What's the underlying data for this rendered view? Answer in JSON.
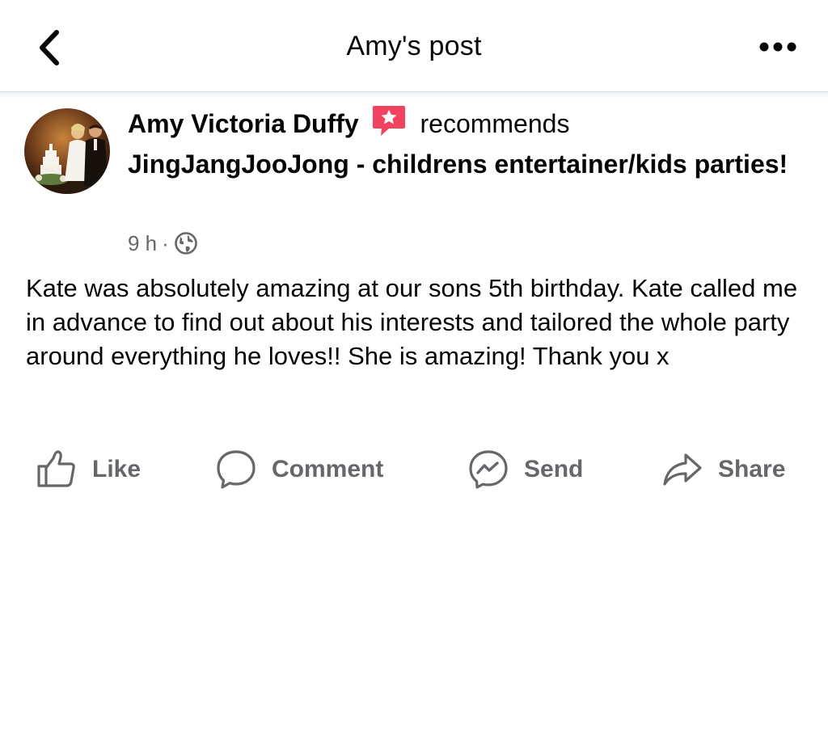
{
  "header": {
    "title": "Amy's post",
    "back_icon": "chevron-left-icon",
    "more_icon": "more-horizontal-icon"
  },
  "post": {
    "author_name": "Amy Victoria Duffy",
    "recommend_icon": "star-speech-bubble-icon",
    "recommend_verb": "recommends",
    "page_name": "JingJangJooJong - childrens entertainer/kids parties!",
    "time": "9 h",
    "separator": "·",
    "privacy_icon": "globe-icon",
    "body": "Kate was absolutely amazing at our sons 5th birthday. Kate called me in advance to find out about his interests and tailored the whole party around everything he loves!! She is amazing! Thank you x"
  },
  "actions": {
    "like": "Like",
    "comment": "Comment",
    "send": "Send",
    "share": "Share"
  },
  "colors": {
    "text": "#050505",
    "secondary_text": "#65676b",
    "recommend_icon": "#f3425f",
    "divider": "#dadde1"
  }
}
